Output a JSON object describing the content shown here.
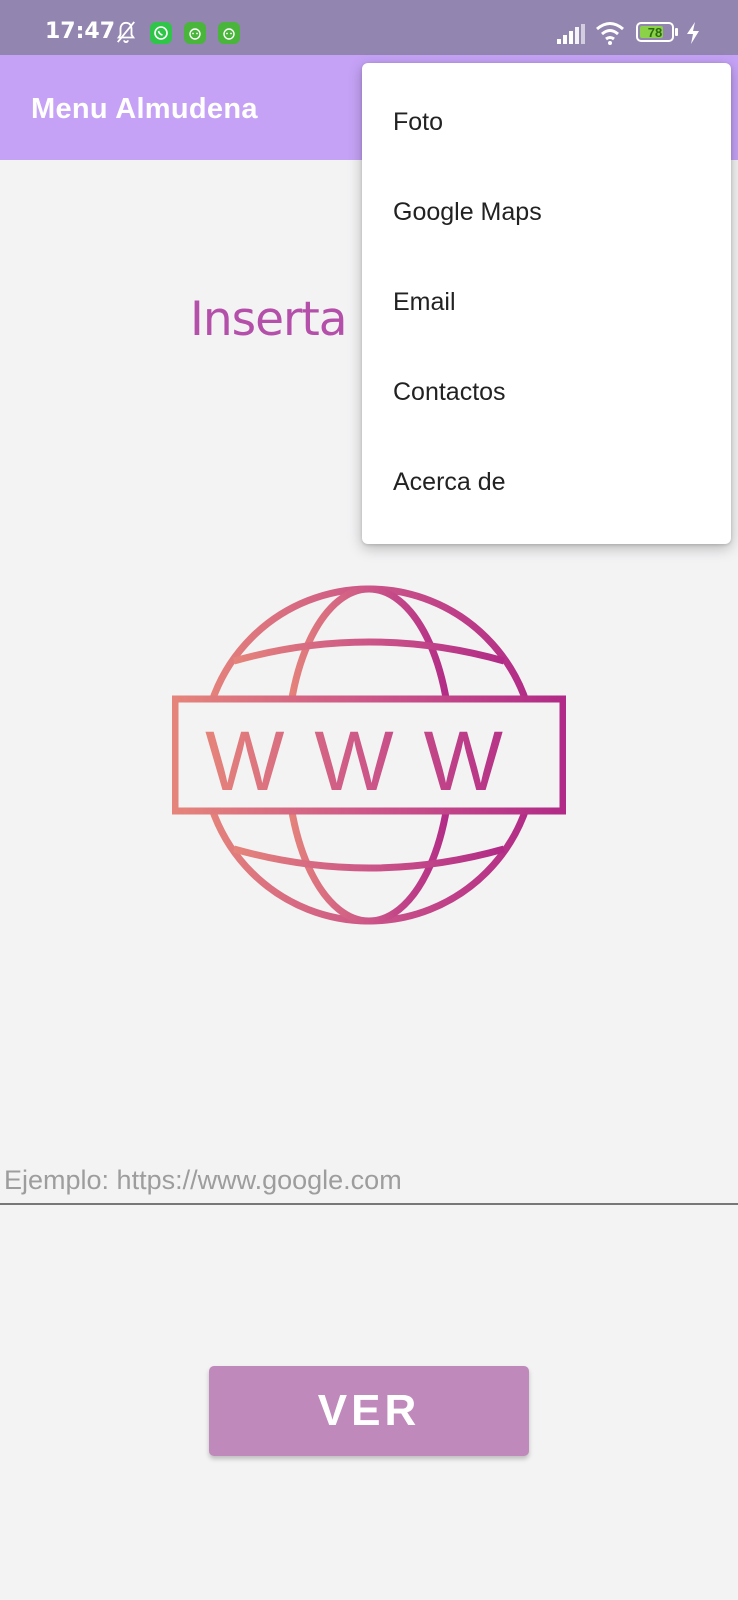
{
  "status_bar": {
    "time": "17:47",
    "battery_level": "78",
    "battery_fraction": 0.78,
    "icons": [
      "bell-off-icon",
      "whatsapp-icon",
      "app-cat-icon",
      "app-cat-icon",
      "signal-icon",
      "wifi-icon",
      "battery-icon",
      "charging-icon"
    ]
  },
  "app_bar": {
    "title": "Menu Almudena",
    "color": "#c5a2f6"
  },
  "main": {
    "heading": "Inserta",
    "heading_color": "#b450a9",
    "globe_text": "WWW",
    "url_placeholder": "Ejemplo: https://www.google.com",
    "url_value": "",
    "button_label": "VER",
    "button_color": "#bf8abb"
  },
  "menu": {
    "items": [
      {
        "label": "Foto"
      },
      {
        "label": "Google Maps"
      },
      {
        "label": "Email"
      },
      {
        "label": "Contactos"
      },
      {
        "label": "Acerca de"
      }
    ]
  }
}
